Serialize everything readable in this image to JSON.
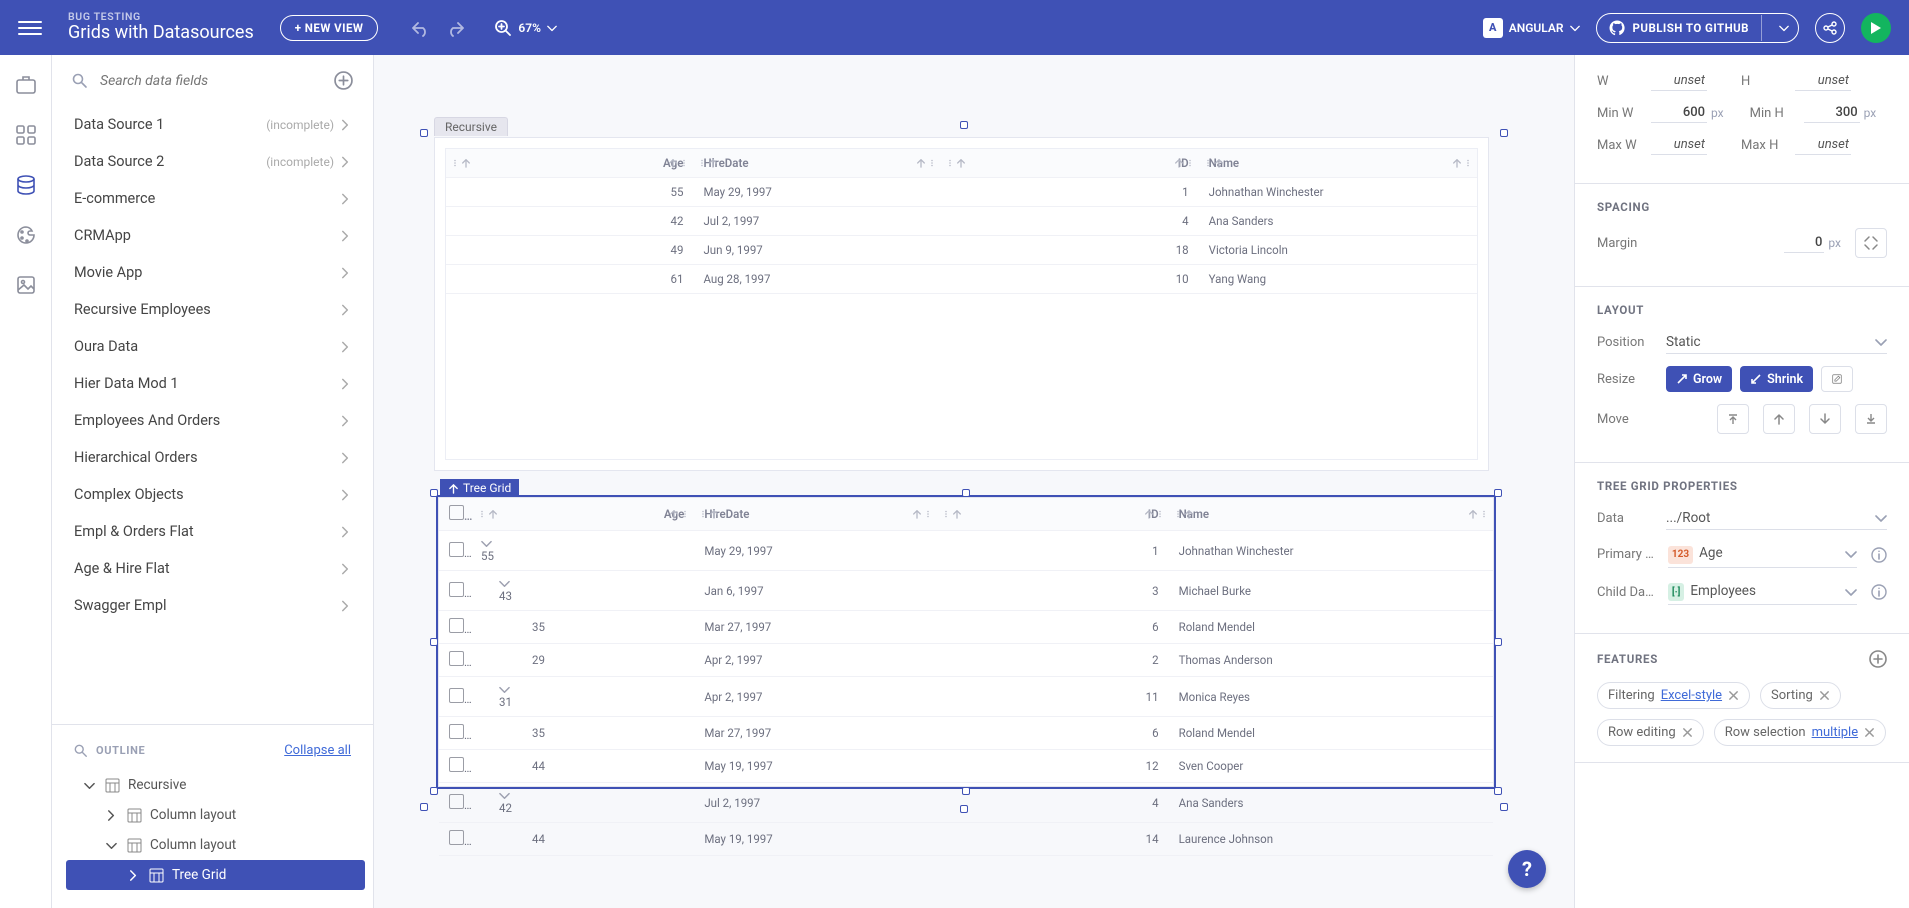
{
  "topbar": {
    "project_label": "BUG TESTING",
    "app_title": "Grids with Datasources",
    "new_view": "+ NEW VIEW",
    "zoom": "67%",
    "framework": "ANGULAR",
    "publish": "PUBLISH TO GITHUB"
  },
  "dataPanel": {
    "search_placeholder": "Search data fields",
    "sources": [
      {
        "label": "Data Source 1",
        "status": "(incomplete)"
      },
      {
        "label": "Data Source 2",
        "status": "(incomplete)"
      },
      {
        "label": "E-commerce",
        "status": ""
      },
      {
        "label": "CRMApp",
        "status": ""
      },
      {
        "label": "Movie App",
        "status": ""
      },
      {
        "label": "Recursive Employees",
        "status": ""
      },
      {
        "label": "Oura Data",
        "status": ""
      },
      {
        "label": "Hier Data Mod 1",
        "status": ""
      },
      {
        "label": "Employees And Orders",
        "status": ""
      },
      {
        "label": "Hierarchical Orders",
        "status": ""
      },
      {
        "label": "Complex Objects",
        "status": ""
      },
      {
        "label": "Empl & Orders Flat",
        "status": ""
      },
      {
        "label": "Age & Hire Flat",
        "status": ""
      },
      {
        "label": "Swagger Empl",
        "status": ""
      }
    ],
    "outline_label": "OUTLINE",
    "collapse_label": "Collapse all",
    "outline": [
      {
        "label": "Recursive",
        "depth": 0,
        "expanded": true,
        "selected": false,
        "icon": "layout"
      },
      {
        "label": "Column layout",
        "depth": 1,
        "expanded": false,
        "selected": false,
        "icon": "cols"
      },
      {
        "label": "Column layout",
        "depth": 1,
        "expanded": true,
        "selected": false,
        "icon": "cols"
      },
      {
        "label": "Tree Grid",
        "depth": 2,
        "expanded": false,
        "selected": true,
        "icon": "tree"
      }
    ]
  },
  "canvas": {
    "grid1_tag": "Recursive",
    "grid2_tag": "Tree Grid",
    "headers": [
      "Age",
      "HireDate",
      "ID",
      "Name"
    ],
    "grid1_rows": [
      {
        "age": "55",
        "date": "May 29, 1997",
        "id": "1",
        "name": "Johnathan Winchester"
      },
      {
        "age": "42",
        "date": "Jul 2, 1997",
        "id": "4",
        "name": "Ana Sanders"
      },
      {
        "age": "49",
        "date": "Jun 9, 1997",
        "id": "18",
        "name": "Victoria Lincoln"
      },
      {
        "age": "61",
        "date": "Aug 28, 1997",
        "id": "10",
        "name": "Yang Wang"
      }
    ],
    "grid2_rows": [
      {
        "level": 0,
        "exp": true,
        "age": "55",
        "date": "May 29, 1997",
        "id": "1",
        "name": "Johnathan Winchester"
      },
      {
        "level": 1,
        "exp": true,
        "age": "43",
        "date": "Jan 6, 1997",
        "id": "3",
        "name": "Michael Burke"
      },
      {
        "level": 2,
        "exp": false,
        "age": "35",
        "date": "Mar 27, 1997",
        "id": "6",
        "name": "Roland Mendel"
      },
      {
        "level": 2,
        "exp": false,
        "age": "29",
        "date": "Apr 2, 1997",
        "id": "2",
        "name": "Thomas Anderson"
      },
      {
        "level": 1,
        "exp": true,
        "age": "31",
        "date": "Apr 2, 1997",
        "id": "11",
        "name": "Monica Reyes"
      },
      {
        "level": 2,
        "exp": false,
        "age": "35",
        "date": "Mar 27, 1997",
        "id": "6",
        "name": "Roland Mendel"
      },
      {
        "level": 2,
        "exp": false,
        "age": "44",
        "date": "May 19, 1997",
        "id": "12",
        "name": "Sven Cooper"
      },
      {
        "level": 1,
        "exp": true,
        "age": "42",
        "date": "Jul 2, 1997",
        "id": "4",
        "name": "Ana Sanders"
      },
      {
        "level": 2,
        "exp": false,
        "age": "44",
        "date": "May 19, 1997",
        "id": "14",
        "name": "Laurence Johnson"
      }
    ]
  },
  "props": {
    "size_W": "unset",
    "size_H": "unset",
    "minW": "600",
    "minH": "300",
    "size_unit": "px",
    "maxW": "unset",
    "maxH": "unset",
    "spacing_title": "SPACING",
    "margin_label": "Margin",
    "margin_value": "0",
    "layout_title": "LAYOUT",
    "position_label": "Position",
    "position_value": "Static",
    "resize_label": "Resize",
    "grow": "Grow",
    "shrink": "Shrink",
    "move_label": "Move",
    "tree_title": "TREE GRID PROPERTIES",
    "data_label": "Data",
    "data_value": ".../Root",
    "primary_label": "Primary …",
    "primary_value": "Age",
    "child_label": "Child Da…",
    "child_value": "Employees",
    "features_title": "FEATURES",
    "chips": [
      {
        "label": "Filtering",
        "link": "Excel-style",
        "closable": true
      },
      {
        "label": "Sorting",
        "link": "",
        "closable": true
      },
      {
        "label": "Row editing",
        "link": "",
        "closable": true
      },
      {
        "label": "Row selection",
        "link": "multiple",
        "closable": true
      }
    ]
  }
}
